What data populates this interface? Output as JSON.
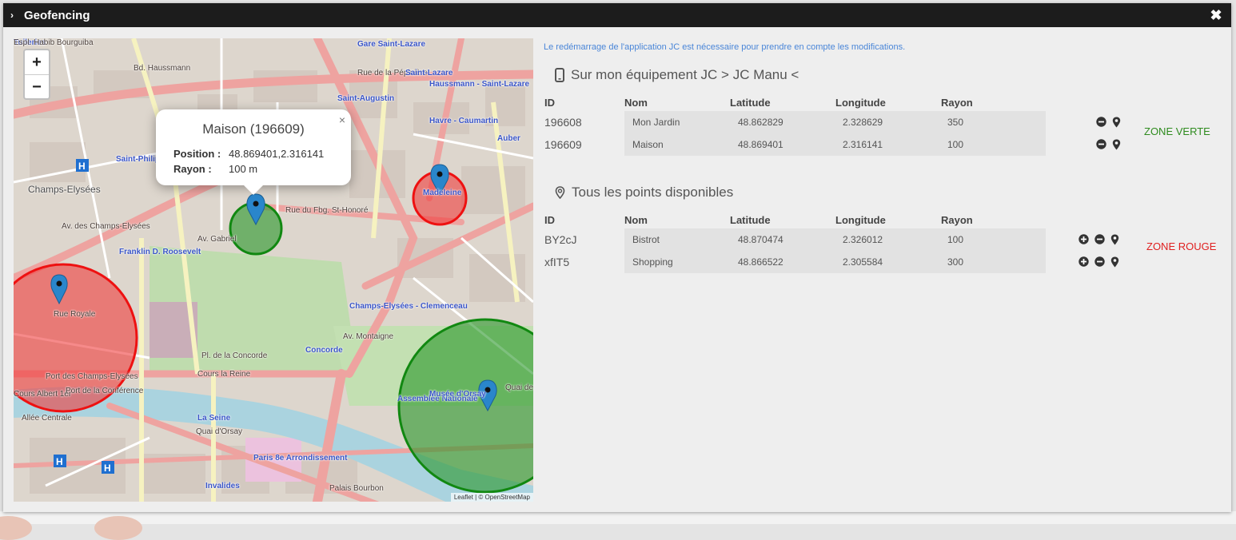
{
  "window": {
    "title": "Geofencing",
    "chevron": "›",
    "close_glyph": "✖"
  },
  "notice": "Le redémarrage de l'application JC est nécessaire pour prendre en compte les modifications.",
  "device_section": {
    "title": "Sur mon équipement JC > JC Manu <",
    "icon": "mobile-phone-icon",
    "columns": [
      "ID",
      "Nom",
      "Latitude",
      "Longitude",
      "Rayon"
    ],
    "rows": [
      {
        "id": "196608",
        "nom": "Mon Jardin",
        "lat": "48.862829",
        "lon": "2.328629",
        "rayon": "350"
      },
      {
        "id": "196609",
        "nom": "Maison",
        "lat": "48.869401",
        "lon": "2.316141",
        "rayon": "100"
      }
    ],
    "zone_label": "ZONE VERTE",
    "zone_color": "#2e8b1e"
  },
  "all_points_section": {
    "title": "Tous les points disponibles",
    "icon": "map-marker-icon",
    "columns": [
      "ID",
      "Nom",
      "Latitude",
      "Longitude",
      "Rayon"
    ],
    "rows": [
      {
        "id": "BY2cJ",
        "nom": "Bistrot",
        "lat": "48.870474",
        "lon": "2.326012",
        "rayon": "100"
      },
      {
        "id": "xfIT5",
        "nom": "Shopping",
        "lat": "48.866522",
        "lon": "2.305584",
        "rayon": "300"
      }
    ],
    "zone_label": "ZONE ROUGE",
    "zone_color": "#e02020"
  },
  "map": {
    "zoom_in": "+",
    "zoom_out": "−",
    "attribution": "Leaflet | © OpenStreetMap",
    "popup": {
      "title": "Maison (196609)",
      "close": "×",
      "position_label": "Position :",
      "position_value": "48.869401,2.316141",
      "rayon_label": "Rayon :",
      "rayon_value": "100 m"
    },
    "labels": [
      {
        "text": "Gare Saint-Lazare",
        "cls": "blue"
      },
      {
        "text": "Bd. Haussmann",
        "cls": ""
      },
      {
        "text": "Rue de la Pépinière",
        "cls": ""
      },
      {
        "text": "Saint-Lazare",
        "cls": "blue"
      },
      {
        "text": "Haussmann - Saint-Lazare",
        "cls": "blue"
      },
      {
        "text": "Saint-Augustin",
        "cls": "blue"
      },
      {
        "text": "Havre - Caumartin",
        "cls": "blue"
      },
      {
        "text": "Auber",
        "cls": "blue"
      },
      {
        "text": "Rue du Fbg. St-Honoré",
        "cls": ""
      },
      {
        "text": "Champs-Elysées",
        "cls": "big"
      },
      {
        "text": "Saint-Philippe du Roule",
        "cls": "blue"
      },
      {
        "text": "Madeleine",
        "cls": "blue"
      },
      {
        "text": "Av. des Champs-Elysées",
        "cls": ""
      },
      {
        "text": "Franklin D. Roosevelt",
        "cls": "blue"
      },
      {
        "text": "Av. Gabriel",
        "cls": ""
      },
      {
        "text": "Champs-Elysées - Clemenceau",
        "cls": "blue"
      },
      {
        "text": "Rue Royale",
        "cls": ""
      },
      {
        "text": "Av. Montaigne",
        "cls": ""
      },
      {
        "text": "Concorde",
        "cls": "blue"
      },
      {
        "text": "Pl. de la Concorde",
        "cls": ""
      },
      {
        "text": "Cours la Reine",
        "cls": ""
      },
      {
        "text": "Port des Champs-Elysées",
        "cls": ""
      },
      {
        "text": "Cours Albert 1er",
        "cls": ""
      },
      {
        "text": "Port de la Conférence",
        "cls": ""
      },
      {
        "text": "La Seine",
        "cls": "blue"
      },
      {
        "text": "Paris 8e Arrondissement",
        "cls": "blue"
      },
      {
        "text": "Quai d'Orsay",
        "cls": ""
      },
      {
        "text": "Invalides",
        "cls": "blue"
      },
      {
        "text": "Palais Bourbon",
        "cls": ""
      },
      {
        "text": "Assemblée Nationale",
        "cls": "blue"
      },
      {
        "text": "Musée d'Orsay",
        "cls": "blue"
      },
      {
        "text": "Quai des Tuileries",
        "cls": ""
      },
      {
        "text": "Allée Centrale",
        "cls": ""
      },
      {
        "text": "Tuileries",
        "cls": "blue"
      },
      {
        "text": "Espl. Habib Bourguiba",
        "cls": ""
      }
    ]
  }
}
